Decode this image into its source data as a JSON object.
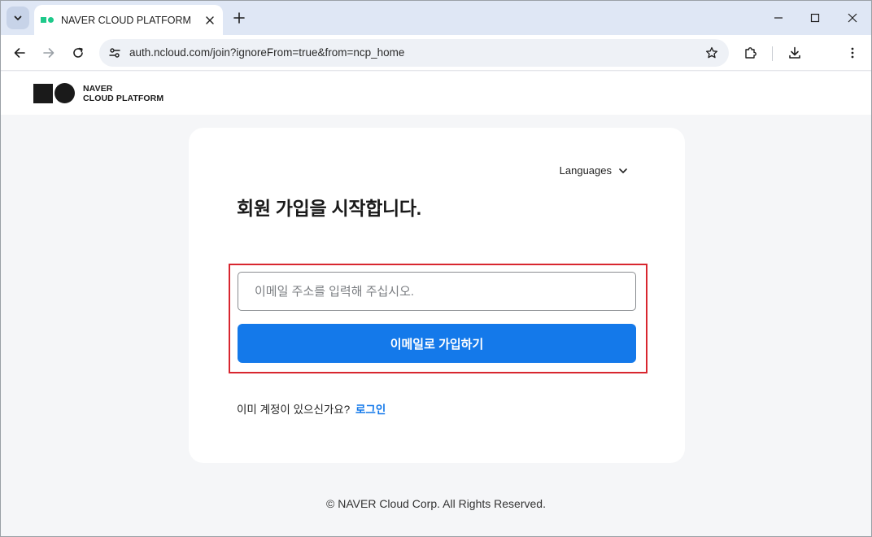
{
  "browser": {
    "tab_title": "NAVER CLOUD PLATFORM",
    "url": "auth.ncloud.com/join?ignoreFrom=true&from=ncp_home"
  },
  "site": {
    "logo_line1": "NAVER",
    "logo_line2": "CLOUD PLATFORM"
  },
  "card": {
    "language_label": "Languages",
    "title": "회원 가입을 시작합니다.",
    "email_placeholder": "이메일 주소를 입력해 주십시오.",
    "email_value": "",
    "join_button": "이메일로 가입하기",
    "login_prompt": "이미 계정이 있으신가요?",
    "login_link": "로그인"
  },
  "footer": {
    "copyright": "© NAVER Cloud Corp. All Rights Reserved."
  },
  "colors": {
    "accent": "#1479ea",
    "highlight": "#d8262f",
    "favicon": "#1ec98a"
  }
}
